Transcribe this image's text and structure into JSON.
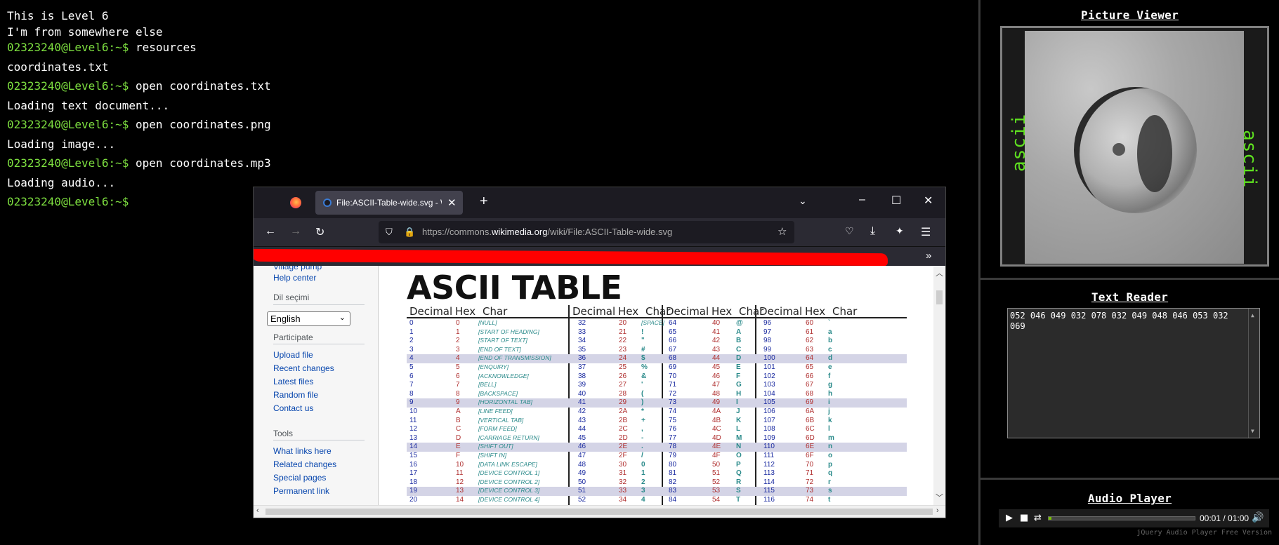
{
  "terminal": {
    "line1": "This is Level 6",
    "line2": "I'm from somewhere else",
    "prompt": "02323240@Level6:~$",
    "cmd1": " resources",
    "out1": "coordinates.txt",
    "cmd2": " open coordinates.txt",
    "out2": "Loading text document...",
    "cmd3": " open coordinates.png",
    "out3": "Loading image...",
    "cmd4": " open coordinates.mp3",
    "out4": "Loading audio..."
  },
  "picture_viewer": {
    "title": "Picture Viewer",
    "label_left": "ascii",
    "label_right": "ascii"
  },
  "text_reader": {
    "title": "Text Reader",
    "content": "052 046 049 032 078 032 049 048 046 053 032 069"
  },
  "audio_player": {
    "title": "Audio Player",
    "time": "00:01 / 01:00",
    "progress": 0.017,
    "footer": "jQuery Audio Player Free Version"
  },
  "browser": {
    "tab_title": "File:ASCII-Table-wide.svg - Wiki",
    "url_prefix": "https://commons.",
    "url_domain": "wikimedia.org",
    "url_path": "/wiki/File:ASCII-Table-wide.svg",
    "sidebar": {
      "cut_item": "Village pump",
      "help": "Help center",
      "lang_heading": "Dil seçimi",
      "lang_value": "English",
      "participate_heading": "Participate",
      "participate": [
        "Upload file",
        "Recent changes",
        "Latest files",
        "Random file",
        "Contact us"
      ],
      "tools_heading": "Tools",
      "tools": [
        "What links here",
        "Related changes",
        "Special pages",
        "Permanent link"
      ]
    },
    "ascii_title": "ASCII TABLE",
    "headers": {
      "dec": "Decimal",
      "hex": "Hex",
      "chr": "Char"
    },
    "rows": [
      {
        "d": "0",
        "h": "0",
        "c": "[NULL]",
        "d2": "32",
        "h2": "20",
        "c2": "[SPACE]",
        "d3": "64",
        "h3": "40",
        "c3": "@",
        "d4": "96",
        "h4": "60",
        "c4": "`"
      },
      {
        "d": "1",
        "h": "1",
        "c": "[START OF HEADING]",
        "d2": "33",
        "h2": "21",
        "c2": "!",
        "d3": "65",
        "h3": "41",
        "c3": "A",
        "d4": "97",
        "h4": "61",
        "c4": "a"
      },
      {
        "d": "2",
        "h": "2",
        "c": "[START OF TEXT]",
        "d2": "34",
        "h2": "22",
        "c2": "\"",
        "d3": "66",
        "h3": "42",
        "c3": "B",
        "d4": "98",
        "h4": "62",
        "c4": "b"
      },
      {
        "d": "3",
        "h": "3",
        "c": "[END OF TEXT]",
        "d2": "35",
        "h2": "23",
        "c2": "#",
        "d3": "67",
        "h3": "43",
        "c3": "C",
        "d4": "99",
        "h4": "63",
        "c4": "c"
      },
      {
        "d": "4",
        "h": "4",
        "c": "[END OF TRANSMISSION]",
        "d2": "36",
        "h2": "24",
        "c2": "$",
        "d3": "68",
        "h3": "44",
        "c3": "D",
        "d4": "100",
        "h4": "64",
        "c4": "d",
        "hl": true
      },
      {
        "d": "5",
        "h": "5",
        "c": "[ENQUIRY]",
        "d2": "37",
        "h2": "25",
        "c2": "%",
        "d3": "69",
        "h3": "45",
        "c3": "E",
        "d4": "101",
        "h4": "65",
        "c4": "e"
      },
      {
        "d": "6",
        "h": "6",
        "c": "[ACKNOWLEDGE]",
        "d2": "38",
        "h2": "26",
        "c2": "&",
        "d3": "70",
        "h3": "46",
        "c3": "F",
        "d4": "102",
        "h4": "66",
        "c4": "f"
      },
      {
        "d": "7",
        "h": "7",
        "c": "[BELL]",
        "d2": "39",
        "h2": "27",
        "c2": "'",
        "d3": "71",
        "h3": "47",
        "c3": "G",
        "d4": "103",
        "h4": "67",
        "c4": "g"
      },
      {
        "d": "8",
        "h": "8",
        "c": "[BACKSPACE]",
        "d2": "40",
        "h2": "28",
        "c2": "(",
        "d3": "72",
        "h3": "48",
        "c3": "H",
        "d4": "104",
        "h4": "68",
        "c4": "h"
      },
      {
        "d": "9",
        "h": "9",
        "c": "[HORIZONTAL TAB]",
        "d2": "41",
        "h2": "29",
        "c2": ")",
        "d3": "73",
        "h3": "49",
        "c3": "I",
        "d4": "105",
        "h4": "69",
        "c4": "i",
        "hl": true
      },
      {
        "d": "10",
        "h": "A",
        "c": "[LINE FEED]",
        "d2": "42",
        "h2": "2A",
        "c2": "*",
        "d3": "74",
        "h3": "4A",
        "c3": "J",
        "d4": "106",
        "h4": "6A",
        "c4": "j"
      },
      {
        "d": "11",
        "h": "B",
        "c": "[VERTICAL TAB]",
        "d2": "43",
        "h2": "2B",
        "c2": "+",
        "d3": "75",
        "h3": "4B",
        "c3": "K",
        "d4": "107",
        "h4": "6B",
        "c4": "k"
      },
      {
        "d": "12",
        "h": "C",
        "c": "[FORM FEED]",
        "d2": "44",
        "h2": "2C",
        "c2": ",",
        "d3": "76",
        "h3": "4C",
        "c3": "L",
        "d4": "108",
        "h4": "6C",
        "c4": "l"
      },
      {
        "d": "13",
        "h": "D",
        "c": "[CARRIAGE RETURN]",
        "d2": "45",
        "h2": "2D",
        "c2": "-",
        "d3": "77",
        "h3": "4D",
        "c3": "M",
        "d4": "109",
        "h4": "6D",
        "c4": "m"
      },
      {
        "d": "14",
        "h": "E",
        "c": "[SHIFT OUT]",
        "d2": "46",
        "h2": "2E",
        "c2": ".",
        "d3": "78",
        "h3": "4E",
        "c3": "N",
        "d4": "110",
        "h4": "6E",
        "c4": "n",
        "hl": true
      },
      {
        "d": "15",
        "h": "F",
        "c": "[SHIFT IN]",
        "d2": "47",
        "h2": "2F",
        "c2": "/",
        "d3": "79",
        "h3": "4F",
        "c3": "O",
        "d4": "111",
        "h4": "6F",
        "c4": "o"
      },
      {
        "d": "16",
        "h": "10",
        "c": "[DATA LINK ESCAPE]",
        "d2": "48",
        "h2": "30",
        "c2": "0",
        "d3": "80",
        "h3": "50",
        "c3": "P",
        "d4": "112",
        "h4": "70",
        "c4": "p"
      },
      {
        "d": "17",
        "h": "11",
        "c": "[DEVICE CONTROL 1]",
        "d2": "49",
        "h2": "31",
        "c2": "1",
        "d3": "81",
        "h3": "51",
        "c3": "Q",
        "d4": "113",
        "h4": "71",
        "c4": "q"
      },
      {
        "d": "18",
        "h": "12",
        "c": "[DEVICE CONTROL 2]",
        "d2": "50",
        "h2": "32",
        "c2": "2",
        "d3": "82",
        "h3": "52",
        "c3": "R",
        "d4": "114",
        "h4": "72",
        "c4": "r"
      },
      {
        "d": "19",
        "h": "13",
        "c": "[DEVICE CONTROL 3]",
        "d2": "51",
        "h2": "33",
        "c2": "3",
        "d3": "83",
        "h3": "53",
        "c3": "S",
        "d4": "115",
        "h4": "73",
        "c4": "s",
        "hl": true
      },
      {
        "d": "20",
        "h": "14",
        "c": "[DEVICE CONTROL 4]",
        "d2": "52",
        "h2": "34",
        "c2": "4",
        "d3": "84",
        "h3": "54",
        "c3": "T",
        "d4": "116",
        "h4": "74",
        "c4": "t"
      }
    ]
  },
  "colors": {
    "prompt_green": "#7ee040",
    "ascii_label_green": "#5fe020",
    "redaction": "#ff0000"
  }
}
